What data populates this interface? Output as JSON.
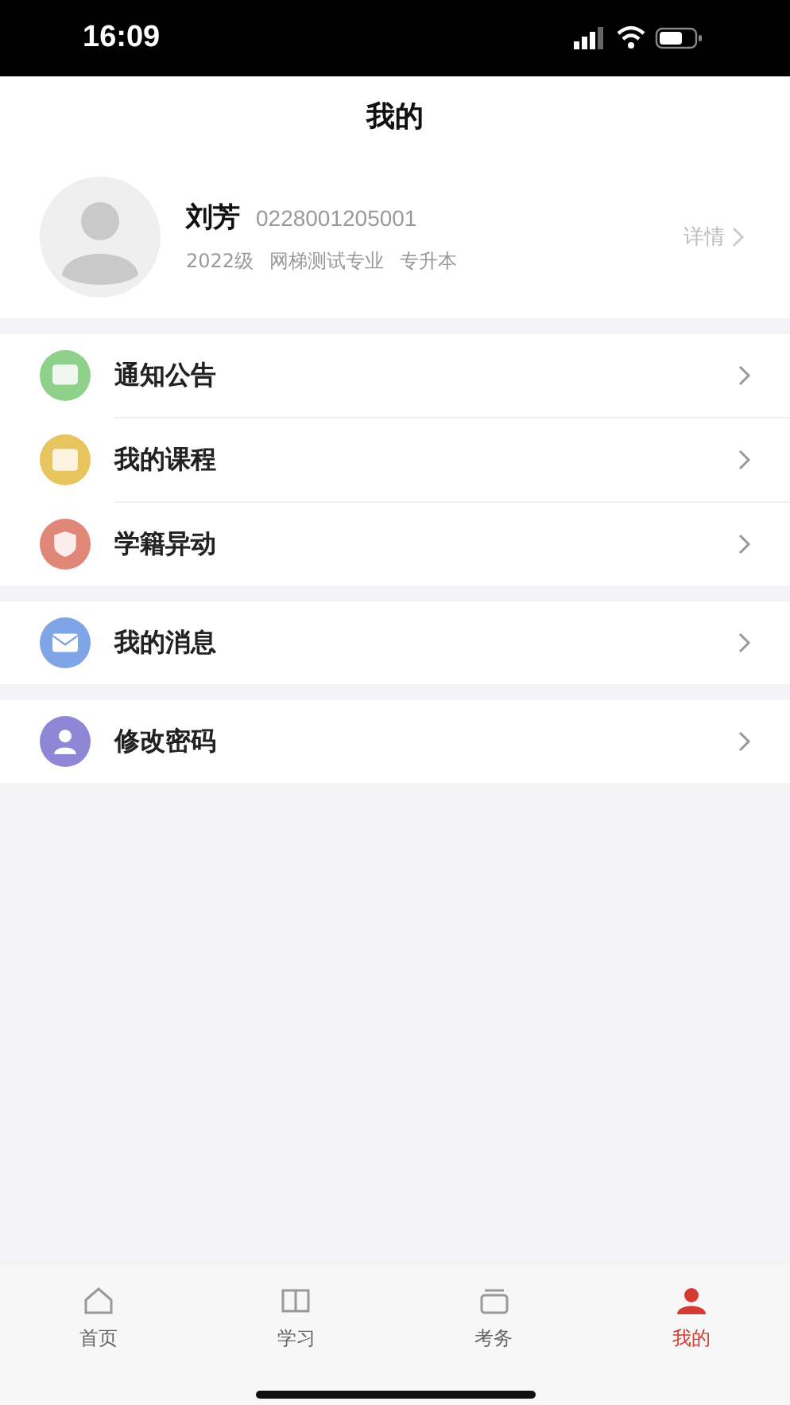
{
  "status_bar": {
    "time": "16:09"
  },
  "header": {
    "title": "我的"
  },
  "profile": {
    "name": "刘芳",
    "student_id": "0228001205001",
    "details": [
      "2022级",
      "网梯测试专业",
      "专升本"
    ],
    "link": "详情"
  },
  "menu_groups": [
    {
      "items": [
        {
          "label": "通知公告",
          "kind": "notice",
          "color": "#8fd18a"
        },
        {
          "label": "我的课程",
          "kind": "course",
          "color": "#e8c45e"
        },
        {
          "label": "学籍异动",
          "kind": "status",
          "color": "#e0877a"
        }
      ]
    },
    {
      "items": [
        {
          "label": "我的消息",
          "kind": "message",
          "color": "#7fa5e6"
        }
      ]
    },
    {
      "items": [
        {
          "label": "修改密码",
          "kind": "password",
          "color": "#8f86d6"
        }
      ]
    }
  ],
  "tab_bar": [
    {
      "label": "首页",
      "kind": "home",
      "selected": false
    },
    {
      "label": "学习",
      "kind": "study",
      "selected": false
    },
    {
      "label": "考务",
      "kind": "exam",
      "selected": false
    },
    {
      "label": "我的",
      "kind": "me",
      "selected": true
    }
  ]
}
